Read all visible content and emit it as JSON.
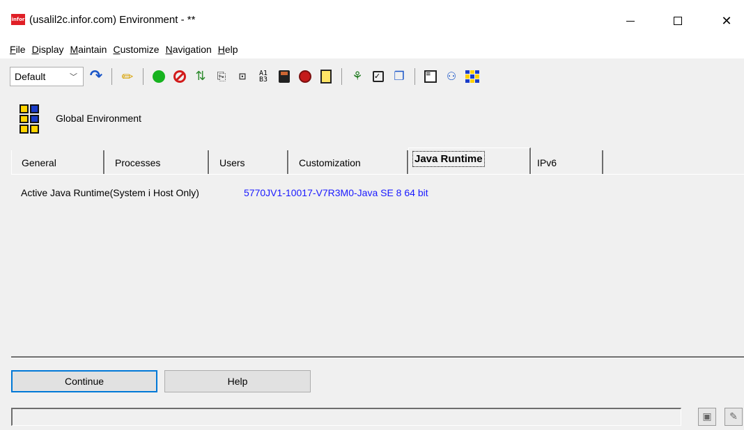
{
  "window": {
    "logo_text": "infor",
    "title": "(usalil2c.infor.com) Environment - **",
    "close_glyph": "✕"
  },
  "menu": [
    "File",
    "Display",
    "Maintain",
    "Customize",
    "Navigation",
    "Help"
  ],
  "toolbar": {
    "view_select": "Default",
    "icons": [
      "refresh-icon",
      "pencil-icon",
      "start-icon",
      "stop-icon",
      "swap-icon",
      "copy-icon",
      "map-icon",
      "alphanumeric-icon",
      "save-icon",
      "red-circle-icon",
      "note-icon",
      "tree-icon",
      "checklist-icon",
      "window-icon",
      "list-icon",
      "people-icon",
      "grid-icon"
    ]
  },
  "header": {
    "title": "Global Environment"
  },
  "tabs": [
    "General",
    "Processes",
    "Users",
    "Customization",
    "Java Runtime",
    "IPv6"
  ],
  "active_tab": "Java Runtime",
  "java_runtime": {
    "label": "Active Java Runtime(System i Host Only)",
    "value": "5770JV1-10017-V7R3M0-Java SE 8 64 bit"
  },
  "buttons": {
    "continue": "Continue",
    "help": "Help"
  },
  "status": {
    "text": ""
  },
  "colors": {
    "link_value": "#1a1aff",
    "focus_border": "#0078d7",
    "brand": "#e01f26"
  }
}
